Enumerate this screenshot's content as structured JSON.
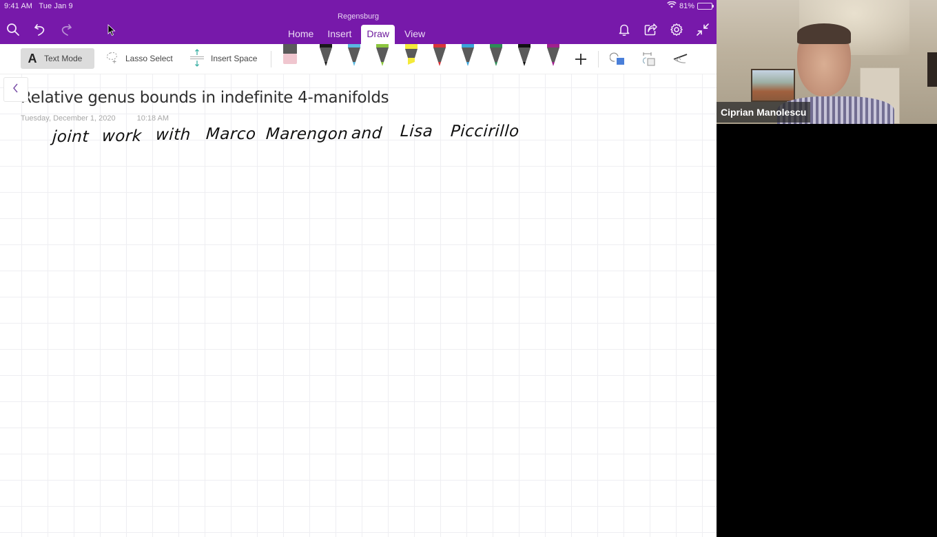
{
  "status_bar": {
    "time": "9:41 AM",
    "date": "Tue Jan 9",
    "battery_percent": "81%",
    "battery_level": 0.81,
    "wifi_icon": "wifi-icon",
    "battery_icon": "battery-charging-icon"
  },
  "header": {
    "notebook_name": "Regensburg",
    "left_icons": [
      "search-icon",
      "undo-icon",
      "redo-icon"
    ],
    "right_icons": [
      "bell-icon",
      "share-icon",
      "gear-icon",
      "collapse-icon"
    ],
    "tabs": [
      {
        "label": "Home",
        "active": false
      },
      {
        "label": "Insert",
        "active": false
      },
      {
        "label": "Draw",
        "active": true
      },
      {
        "label": "View",
        "active": false
      }
    ],
    "accent_color": "#7719aa"
  },
  "toolbar": {
    "text_mode": {
      "label": "Text Mode",
      "glyph": "A",
      "active": true
    },
    "lasso_select": {
      "label": "Lasso Select"
    },
    "insert_space": {
      "label": "Insert Space"
    },
    "eraser": {
      "name": "eraser",
      "color": "#f0c6cf"
    },
    "pens": [
      {
        "name": "black-pen",
        "color": "#1a1a1a"
      },
      {
        "name": "light-blue-pen",
        "color": "#5ab8e0"
      },
      {
        "name": "green-pen",
        "color": "#8cc63f"
      },
      {
        "name": "yellow-highlighter",
        "color": "#f4ea3a"
      },
      {
        "name": "red-pen",
        "color": "#d9343a"
      },
      {
        "name": "blue-pen",
        "color": "#3aa3d9"
      },
      {
        "name": "dark-green-pen",
        "color": "#2e8b57"
      },
      {
        "name": "black-pen-2",
        "color": "#111111"
      },
      {
        "name": "purple-pen",
        "color": "#a0208e"
      }
    ],
    "right_tools": [
      "add-pen-icon",
      "shapes-icon",
      "ink-to-shape-icon",
      "ruler-icon"
    ]
  },
  "page": {
    "title": "Relative genus bounds in indefinite 4-manifolds",
    "date": "Tuesday, December 1, 2020",
    "time": "10:18 AM",
    "handwritten_words": [
      "joint",
      "work",
      "with",
      "Marco",
      "Marengon",
      "and",
      "Lisa",
      "Piccirillo"
    ]
  },
  "video": {
    "participant_name": "Ciprian Manolescu"
  }
}
